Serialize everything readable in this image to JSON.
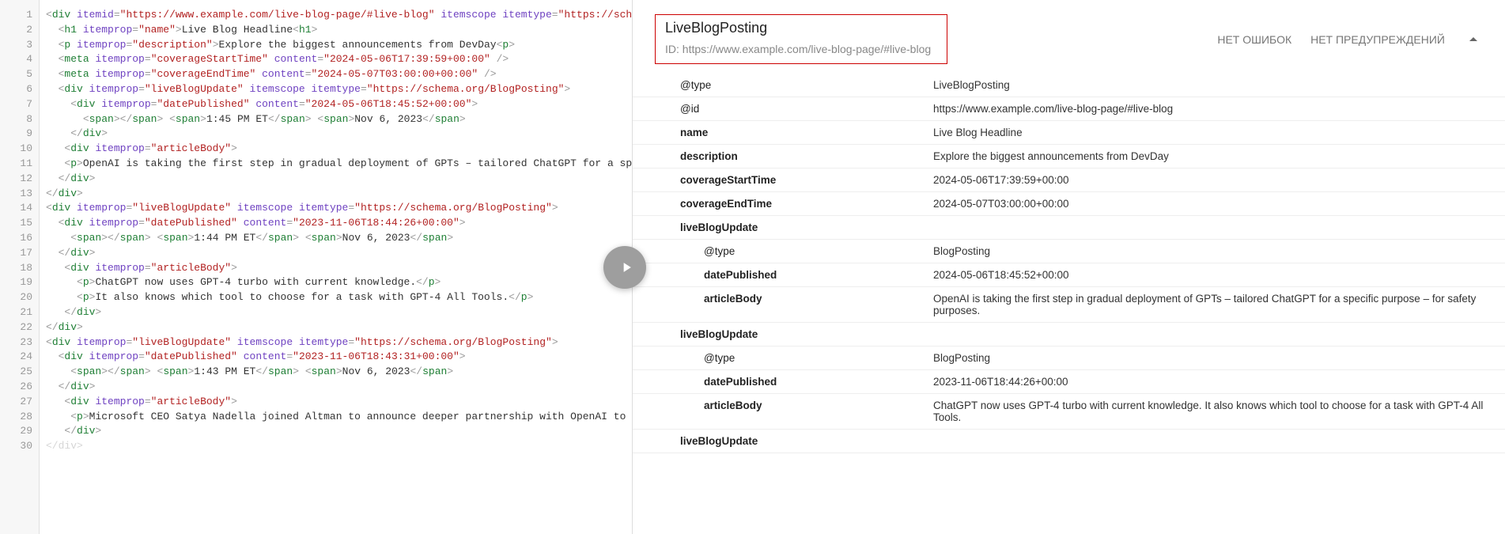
{
  "header": {
    "title": "LiveBlogPosting",
    "id_label": "ID: https://www.example.com/live-blog-page/#live-blog",
    "no_errors": "НЕТ ОШИБОК",
    "no_warnings": "НЕТ ПРЕДУПРЕЖДЕНИЙ"
  },
  "code_lines": [
    {
      "n": "1",
      "html": "<span class='t-punct'>&lt;</span><span class='t-tag'>div</span> <span class='t-attr'>itemid</span><span class='t-punct'>=</span><span class='t-val'>\"https://www.example.com/live-blog-page/#live-blog\"</span> <span class='t-attr'>itemscope</span> <span class='t-attr'>itemtype</span><span class='t-punct'>=</span><span class='t-val'>\"https://schema.o</span>"
    },
    {
      "n": "2",
      "html": "  <span class='t-punct'>&lt;</span><span class='t-tag'>h1</span> <span class='t-attr'>itemprop</span><span class='t-punct'>=</span><span class='t-val'>\"name\"</span><span class='t-punct'>&gt;</span><span class='t-text'>Live Blog Headline</span><span class='t-punct'>&lt;</span><span class='t-tag'>h1</span><span class='t-punct'>&gt;</span>"
    },
    {
      "n": "3",
      "html": "  <span class='t-punct'>&lt;</span><span class='t-tag'>p</span> <span class='t-attr'>itemprop</span><span class='t-punct'>=</span><span class='t-val'>\"description\"</span><span class='t-punct'>&gt;</span><span class='t-text'>Explore the biggest announcements from DevDay</span><span class='t-punct'>&lt;</span><span class='t-tag'>p</span><span class='t-punct'>&gt;</span>"
    },
    {
      "n": "4",
      "html": "  <span class='t-punct'>&lt;</span><span class='t-tag'>meta</span> <span class='t-attr'>itemprop</span><span class='t-punct'>=</span><span class='t-val'>\"coverageStartTime\"</span> <span class='t-attr'>content</span><span class='t-punct'>=</span><span class='t-val'>\"2024-05-06T17:39:59+00:00\"</span> <span class='t-punct'>/&gt;</span>"
    },
    {
      "n": "5",
      "html": "  <span class='t-punct'>&lt;</span><span class='t-tag'>meta</span> <span class='t-attr'>itemprop</span><span class='t-punct'>=</span><span class='t-val'>\"coverageEndTime\"</span> <span class='t-attr'>content</span><span class='t-punct'>=</span><span class='t-val'>\"2024-05-07T03:00:00+00:00\"</span> <span class='t-punct'>/&gt;</span>"
    },
    {
      "n": "6",
      "html": "  <span class='t-punct'>&lt;</span><span class='t-tag'>div</span> <span class='t-attr'>itemprop</span><span class='t-punct'>=</span><span class='t-val'>\"liveBlogUpdate\"</span> <span class='t-attr'>itemscope</span> <span class='t-attr'>itemtype</span><span class='t-punct'>=</span><span class='t-val'>\"https://schema.org/BlogPosting\"</span><span class='t-punct'>&gt;</span>"
    },
    {
      "n": "7",
      "html": "    <span class='t-punct'>&lt;</span><span class='t-tag'>div</span> <span class='t-attr'>itemprop</span><span class='t-punct'>=</span><span class='t-val'>\"datePublished\"</span> <span class='t-attr'>content</span><span class='t-punct'>=</span><span class='t-val'>\"2024-05-06T18:45:52+00:00\"</span><span class='t-punct'>&gt;</span>"
    },
    {
      "n": "8",
      "html": "      <span class='t-punct'>&lt;</span><span class='t-tag'>span</span><span class='t-punct'>&gt;&lt;/</span><span class='t-tag'>span</span><span class='t-punct'>&gt;</span> <span class='t-punct'>&lt;</span><span class='t-tag'>span</span><span class='t-punct'>&gt;</span><span class='t-text'>1:45 PM ET</span><span class='t-punct'>&lt;/</span><span class='t-tag'>span</span><span class='t-punct'>&gt;</span> <span class='t-punct'>&lt;</span><span class='t-tag'>span</span><span class='t-punct'>&gt;</span><span class='t-text'>Nov 6, 2023</span><span class='t-punct'>&lt;/</span><span class='t-tag'>span</span><span class='t-punct'>&gt;</span>"
    },
    {
      "n": "9",
      "html": "    <span class='t-punct'>&lt;/</span><span class='t-tag'>div</span><span class='t-punct'>&gt;</span>"
    },
    {
      "n": "10",
      "html": "   <span class='t-punct'>&lt;</span><span class='t-tag'>div</span> <span class='t-attr'>itemprop</span><span class='t-punct'>=</span><span class='t-val'>\"articleBody\"</span><span class='t-punct'>&gt;</span>"
    },
    {
      "n": "11",
      "html": "   <span class='t-punct'>&lt;</span><span class='t-tag'>p</span><span class='t-punct'>&gt;</span><span class='t-text'>OpenAI is taking the first step in gradual deployment of GPTs – tailored ChatGPT for a specif</span>"
    },
    {
      "n": "12",
      "html": "  <span class='t-punct'>&lt;/</span><span class='t-tag'>div</span><span class='t-punct'>&gt;</span>"
    },
    {
      "n": "13",
      "html": "<span class='t-punct'>&lt;/</span><span class='t-tag'>div</span><span class='t-punct'>&gt;</span>"
    },
    {
      "n": "14",
      "html": "<span class='t-punct'>&lt;</span><span class='t-tag'>div</span> <span class='t-attr'>itemprop</span><span class='t-punct'>=</span><span class='t-val'>\"liveBlogUpdate\"</span> <span class='t-attr'>itemscope</span> <span class='t-attr'>itemtype</span><span class='t-punct'>=</span><span class='t-val'>\"https://schema.org/BlogPosting\"</span><span class='t-punct'>&gt;</span>"
    },
    {
      "n": "15",
      "html": "  <span class='t-punct'>&lt;</span><span class='t-tag'>div</span> <span class='t-attr'>itemprop</span><span class='t-punct'>=</span><span class='t-val'>\"datePublished\"</span> <span class='t-attr'>content</span><span class='t-punct'>=</span><span class='t-val'>\"2023-11-06T18:44:26+00:00\"</span><span class='t-punct'>&gt;</span>"
    },
    {
      "n": "16",
      "html": "    <span class='t-punct'>&lt;</span><span class='t-tag'>span</span><span class='t-punct'>&gt;&lt;/</span><span class='t-tag'>span</span><span class='t-punct'>&gt;</span> <span class='t-punct'>&lt;</span><span class='t-tag'>span</span><span class='t-punct'>&gt;</span><span class='t-text'>1:44 PM ET</span><span class='t-punct'>&lt;/</span><span class='t-tag'>span</span><span class='t-punct'>&gt;</span> <span class='t-punct'>&lt;</span><span class='t-tag'>span</span><span class='t-punct'>&gt;</span><span class='t-text'>Nov 6, 2023</span><span class='t-punct'>&lt;/</span><span class='t-tag'>span</span><span class='t-punct'>&gt;</span>"
    },
    {
      "n": "17",
      "html": "  <span class='t-punct'>&lt;/</span><span class='t-tag'>div</span><span class='t-punct'>&gt;</span>"
    },
    {
      "n": "18",
      "html": "   <span class='t-punct'>&lt;</span><span class='t-tag'>div</span> <span class='t-attr'>itemprop</span><span class='t-punct'>=</span><span class='t-val'>\"articleBody\"</span><span class='t-punct'>&gt;</span>"
    },
    {
      "n": "19",
      "html": "     <span class='t-punct'>&lt;</span><span class='t-tag'>p</span><span class='t-punct'>&gt;</span><span class='t-text'>ChatGPT now uses GPT-4 turbo with current knowledge.</span><span class='t-punct'>&lt;/</span><span class='t-tag'>p</span><span class='t-punct'>&gt;</span>"
    },
    {
      "n": "20",
      "html": "     <span class='t-punct'>&lt;</span><span class='t-tag'>p</span><span class='t-punct'>&gt;</span><span class='t-text'>It also knows which tool to choose for a task with GPT-4 All Tools.</span><span class='t-punct'>&lt;/</span><span class='t-tag'>p</span><span class='t-punct'>&gt;</span>"
    },
    {
      "n": "21",
      "html": "   <span class='t-punct'>&lt;/</span><span class='t-tag'>div</span><span class='t-punct'>&gt;</span>"
    },
    {
      "n": "22",
      "html": "<span class='t-punct'>&lt;/</span><span class='t-tag'>div</span><span class='t-punct'>&gt;</span>"
    },
    {
      "n": "23",
      "html": "<span class='t-punct'>&lt;</span><span class='t-tag'>div</span> <span class='t-attr'>itemprop</span><span class='t-punct'>=</span><span class='t-val'>\"liveBlogUpdate\"</span> <span class='t-attr'>itemscope</span> <span class='t-attr'>itemtype</span><span class='t-punct'>=</span><span class='t-val'>\"https://schema.org/BlogPosting\"</span><span class='t-punct'>&gt;</span>"
    },
    {
      "n": "24",
      "html": "  <span class='t-punct'>&lt;</span><span class='t-tag'>div</span> <span class='t-attr'>itemprop</span><span class='t-punct'>=</span><span class='t-val'>\"datePublished\"</span> <span class='t-attr'>content</span><span class='t-punct'>=</span><span class='t-val'>\"2023-11-06T18:43:31+00:00\"</span><span class='t-punct'>&gt;</span>"
    },
    {
      "n": "25",
      "html": "    <span class='t-punct'>&lt;</span><span class='t-tag'>span</span><span class='t-punct'>&gt;&lt;/</span><span class='t-tag'>span</span><span class='t-punct'>&gt;</span> <span class='t-punct'>&lt;</span><span class='t-tag'>span</span><span class='t-punct'>&gt;</span><span class='t-text'>1:43 PM ET</span><span class='t-punct'>&lt;/</span><span class='t-tag'>span</span><span class='t-punct'>&gt;</span> <span class='t-punct'>&lt;</span><span class='t-tag'>span</span><span class='t-punct'>&gt;</span><span class='t-text'>Nov 6, 2023</span><span class='t-punct'>&lt;/</span><span class='t-tag'>span</span><span class='t-punct'>&gt;</span>"
    },
    {
      "n": "26",
      "html": "  <span class='t-punct'>&lt;/</span><span class='t-tag'>div</span><span class='t-punct'>&gt;</span>"
    },
    {
      "n": "27",
      "html": "   <span class='t-punct'>&lt;</span><span class='t-tag'>div</span> <span class='t-attr'>itemprop</span><span class='t-punct'>=</span><span class='t-val'>\"articleBody\"</span><span class='t-punct'>&gt;</span>"
    },
    {
      "n": "28",
      "html": "    <span class='t-punct'>&lt;</span><span class='t-tag'>p</span><span class='t-punct'>&gt;</span><span class='t-text'>Microsoft CEO Satya Nadella joined Altman to announce deeper partnership with OpenAI to help </span>"
    },
    {
      "n": "29",
      "html": "   <span class='t-punct'>&lt;/</span><span class='t-tag'>div</span><span class='t-punct'>&gt;</span>"
    },
    {
      "n": "30",
      "html": "<span class='t-punct' style='opacity:.4'>&lt;/div&gt;</span>"
    }
  ],
  "props": [
    {
      "indent": 1,
      "key": "@type",
      "val": "LiveBlogPosting",
      "bold": false
    },
    {
      "indent": 1,
      "key": "@id",
      "val": "https://www.example.com/live-blog-page/#live-blog",
      "bold": false
    },
    {
      "indent": 1,
      "key": "name",
      "val": "Live Blog Headline",
      "bold": true
    },
    {
      "indent": 1,
      "key": "description",
      "val": "Explore the biggest announcements from DevDay",
      "bold": true
    },
    {
      "indent": 1,
      "key": "coverageStartTime",
      "val": "2024-05-06T17:39:59+00:00",
      "bold": true
    },
    {
      "indent": 1,
      "key": "coverageEndTime",
      "val": "2024-05-07T03:00:00+00:00",
      "bold": true
    },
    {
      "indent": 1,
      "key": "liveBlogUpdate",
      "val": "",
      "bold": true
    },
    {
      "indent": 2,
      "key": "@type",
      "val": "BlogPosting",
      "bold": false
    },
    {
      "indent": 2,
      "key": "datePublished",
      "val": "2024-05-06T18:45:52+00:00",
      "bold": true
    },
    {
      "indent": 2,
      "key": "articleBody",
      "val": "OpenAI is taking the first step in gradual deployment of GPTs – tailored ChatGPT for a specific purpose – for safety purposes.",
      "bold": true
    },
    {
      "indent": 1,
      "key": "liveBlogUpdate",
      "val": "",
      "bold": true
    },
    {
      "indent": 2,
      "key": "@type",
      "val": "BlogPosting",
      "bold": false
    },
    {
      "indent": 2,
      "key": "datePublished",
      "val": "2023-11-06T18:44:26+00:00",
      "bold": true
    },
    {
      "indent": 2,
      "key": "articleBody",
      "val": "ChatGPT now uses GPT-4 turbo with current knowledge. It also knows which tool to choose for a task with GPT-4 All Tools.",
      "bold": true
    },
    {
      "indent": 1,
      "key": "liveBlogUpdate",
      "val": "",
      "bold": true
    }
  ]
}
